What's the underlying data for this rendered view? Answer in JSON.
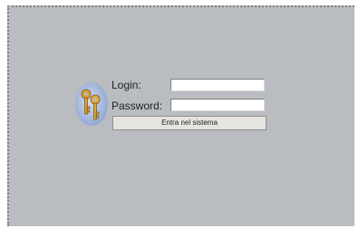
{
  "login_form": {
    "login_label": "Login:",
    "login_value": "",
    "password_label": "Password:",
    "password_value": "",
    "submit_label": "Entra nel sistema",
    "icon": "keys-icon"
  },
  "colors": {
    "background": "#b9bcc0",
    "input_background": "#ffffff",
    "button_background": "#e6e4df",
    "icon_circle": "#a9bde0",
    "key_gold": "#d9a032"
  }
}
